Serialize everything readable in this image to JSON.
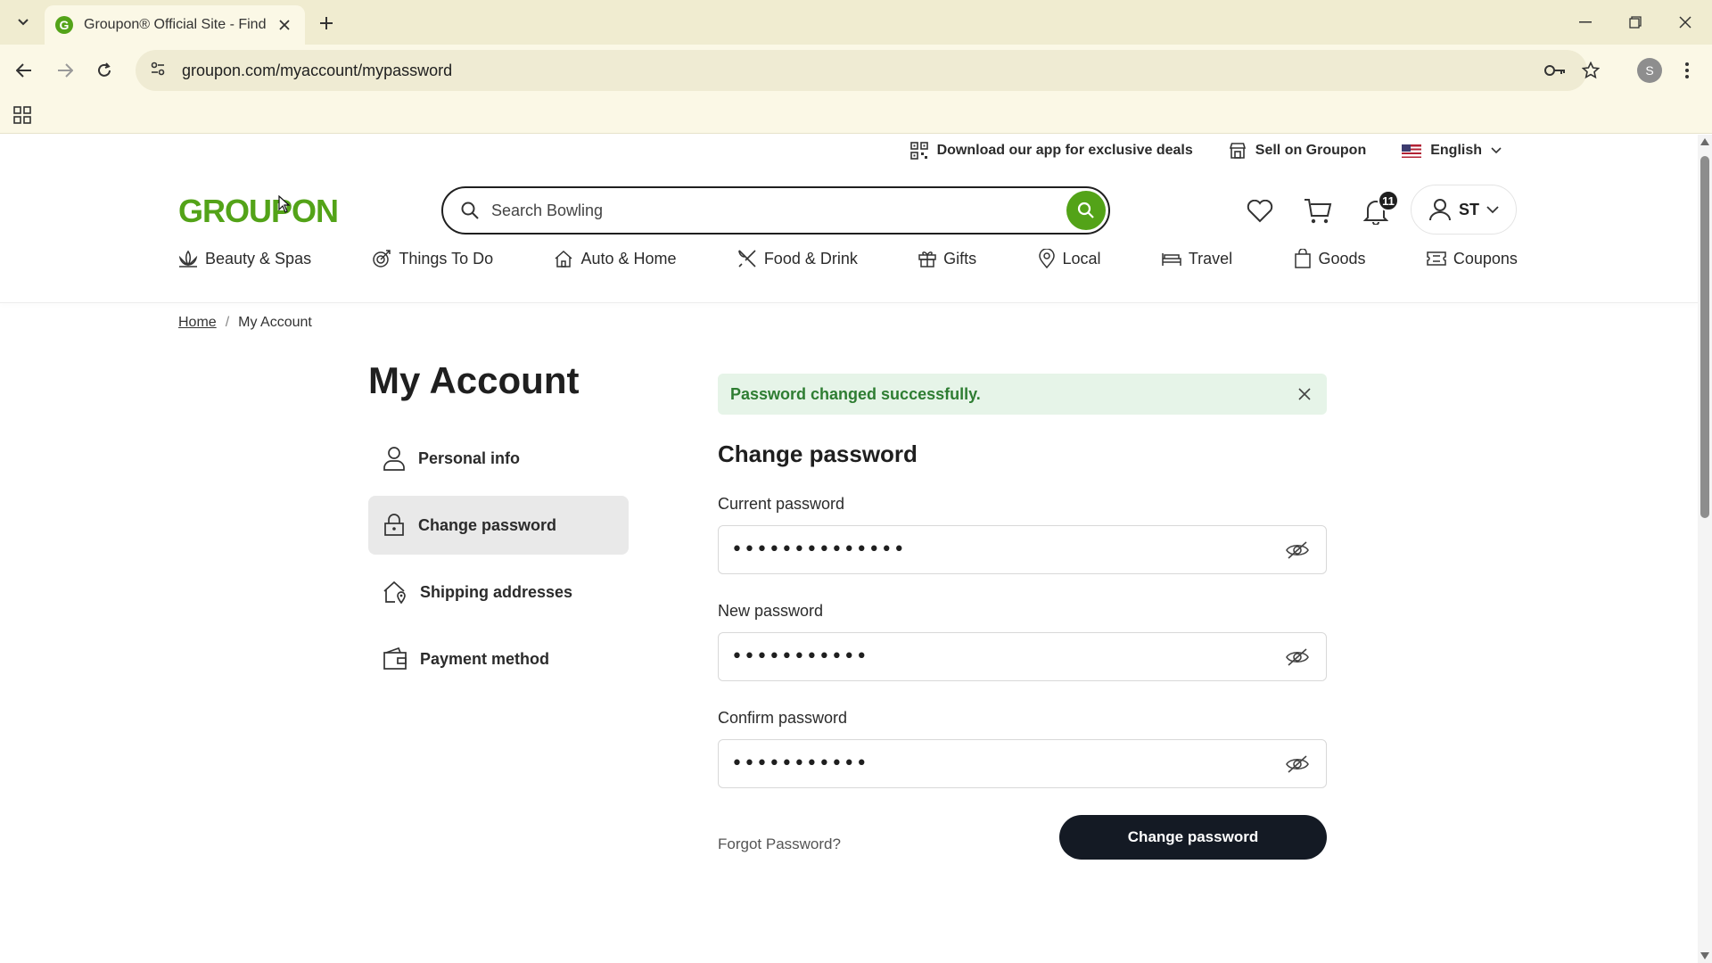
{
  "browser": {
    "tab_title": "Groupon® Official Site - Find L",
    "tab_favicon": "G",
    "url": "groupon.com/myaccount/mypassword",
    "profile_initial": "S"
  },
  "topstrip": {
    "download_app": "Download our app for exclusive deals",
    "sell": "Sell on Groupon",
    "language": "English"
  },
  "header": {
    "logo": "GROUPON",
    "search_placeholder": "Search Bowling",
    "notification_count": "11",
    "user_initials": "ST"
  },
  "categories": [
    {
      "label": "Beauty & Spas",
      "icon": "lotus-icon"
    },
    {
      "label": "Things To Do",
      "icon": "target-icon"
    },
    {
      "label": "Auto & Home",
      "icon": "home-icon"
    },
    {
      "label": "Food & Drink",
      "icon": "utensils-icon"
    },
    {
      "label": "Gifts",
      "icon": "gift-icon"
    },
    {
      "label": "Local",
      "icon": "map-pin-icon"
    },
    {
      "label": "Travel",
      "icon": "bed-icon"
    },
    {
      "label": "Goods",
      "icon": "shopping-bag-icon"
    },
    {
      "label": "Coupons",
      "icon": "coupon-icon"
    }
  ],
  "breadcrumb": {
    "home": "Home",
    "separator": "/",
    "current": "My Account"
  },
  "account": {
    "title": "My Account",
    "nav": [
      {
        "label": "Personal info",
        "icon": "person-icon",
        "active": false
      },
      {
        "label": "Change password",
        "icon": "lock-icon",
        "active": true
      },
      {
        "label": "Shipping addresses",
        "icon": "house-pin-icon",
        "active": false
      },
      {
        "label": "Payment method",
        "icon": "wallet-icon",
        "active": false
      }
    ]
  },
  "form": {
    "alert": "Password changed successfully.",
    "title": "Change password",
    "current_label": "Current password",
    "current_value": "••••••••••••••",
    "new_label": "New password",
    "new_value": "•••••••••••",
    "confirm_label": "Confirm password",
    "confirm_value": "•••••••••••",
    "forgot": "Forgot Password?",
    "submit": "Change password"
  },
  "colors": {
    "brand_green": "#53a318",
    "success_bg": "#e6f4e8",
    "success_text": "#2e7d32",
    "button_dark": "#141a24"
  }
}
